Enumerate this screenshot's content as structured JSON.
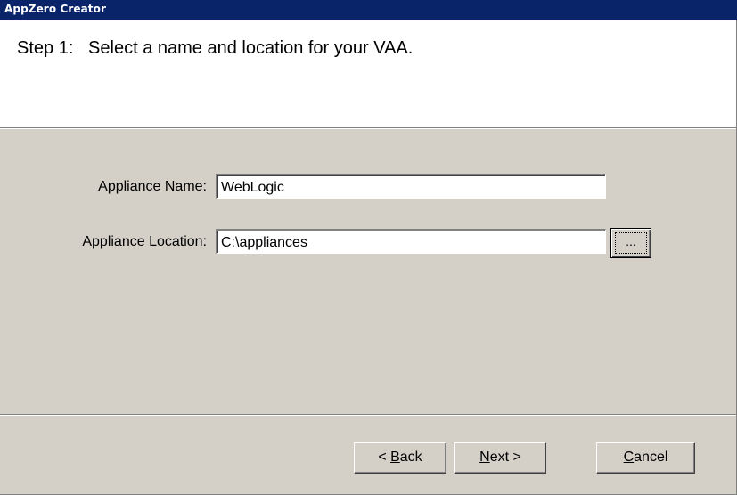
{
  "window": {
    "title": "AppZero Creator"
  },
  "header": {
    "step_title": "Step 1:   Select a name and location for your VAA."
  },
  "form": {
    "name_label": "Appliance Name:",
    "name_value": "WebLogic",
    "location_label": "Appliance Location:",
    "location_value": "C:\\appliances",
    "browse_label": "..."
  },
  "buttons": {
    "back": {
      "prefix": "< ",
      "mnemonic": "B",
      "rest": "ack"
    },
    "next": {
      "prefix": "",
      "mnemonic": "N",
      "rest": "ext >"
    },
    "cancel": {
      "prefix": "",
      "mnemonic": "C",
      "rest": "ancel"
    }
  }
}
